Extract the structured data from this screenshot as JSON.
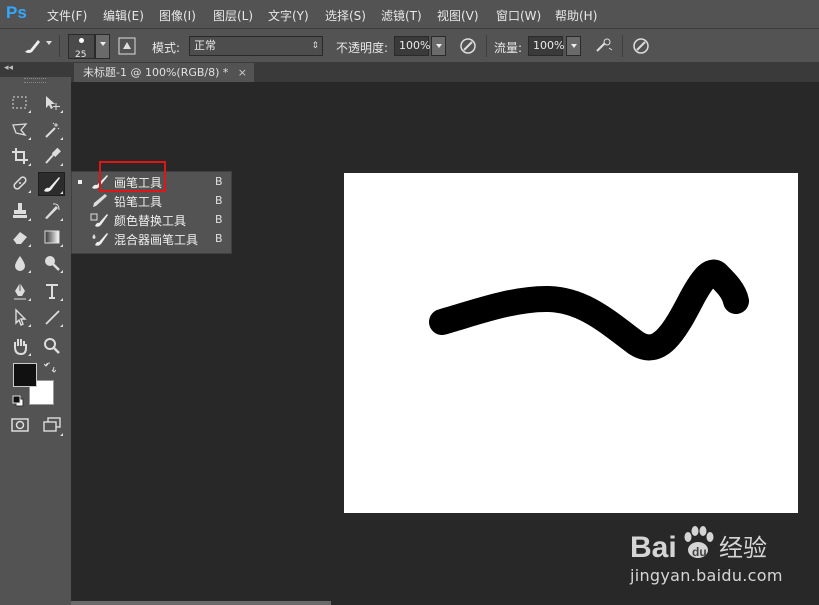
{
  "app": {
    "logo": "Ps"
  },
  "menu": [
    "文件(F)",
    "编辑(E)",
    "图像(I)",
    "图层(L)",
    "文字(Y)",
    "选择(S)",
    "滤镜(T)",
    "视图(V)",
    "窗口(W)",
    "帮助(H)"
  ],
  "options": {
    "brush_size": "25",
    "mode_label": "模式:",
    "mode_value": "正常",
    "opacity_label": "不透明度:",
    "opacity_value": "100%",
    "flow_label": "流量:",
    "flow_value": "100%"
  },
  "panel": {
    "collapse": "◂◂"
  },
  "document": {
    "tab_title": "未标题-1 @ 100%(RGB/8) *",
    "close": "×"
  },
  "flyout": {
    "items": [
      {
        "label": "画笔工具",
        "shortcut": "B",
        "icon": "brush-icon",
        "selected": true
      },
      {
        "label": "铅笔工具",
        "shortcut": "B",
        "icon": "pencil-icon",
        "selected": false
      },
      {
        "label": "颜色替换工具",
        "shortcut": "B",
        "icon": "color-replacement-icon",
        "selected": false
      },
      {
        "label": "混合器画笔工具",
        "shortcut": "B",
        "icon": "mixer-brush-icon",
        "selected": false
      }
    ]
  },
  "tools": [
    "marquee",
    "move",
    "lasso",
    "magic-wand",
    "crop",
    "eyedropper",
    "healing",
    "brush",
    "stamp",
    "history-brush",
    "eraser",
    "gradient",
    "blur",
    "dodge",
    "pen",
    "type",
    "path-select",
    "line",
    "hand",
    "zoom"
  ],
  "colors": {
    "foreground": "#111111",
    "background": "#ffffff",
    "highlight": "#e01515",
    "ps_blue": "#31a8ff"
  },
  "watermark": {
    "brand": "Baidu经验",
    "url": "jingyan.baidu.com"
  }
}
